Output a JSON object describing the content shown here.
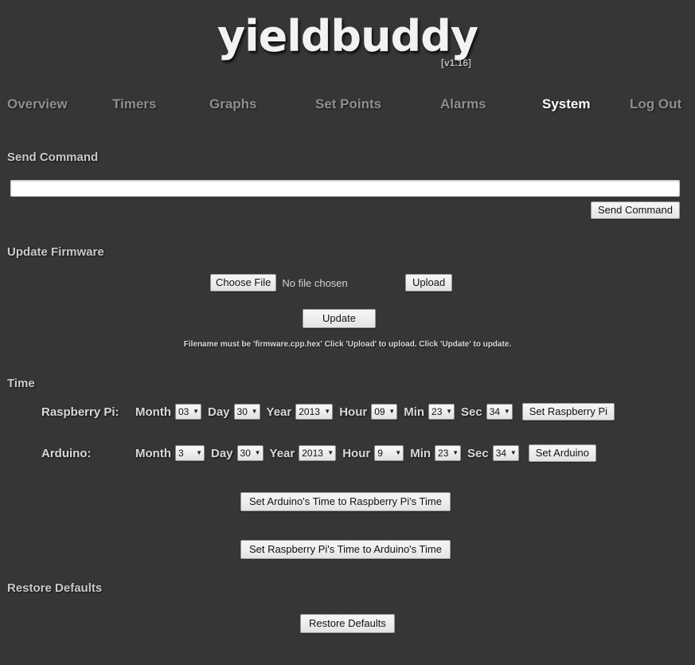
{
  "header": {
    "logo": "yieldbuddy",
    "version": "[v1.16]"
  },
  "nav": {
    "items": [
      {
        "label": "Overview",
        "active": false
      },
      {
        "label": "Timers",
        "active": false
      },
      {
        "label": "Graphs",
        "active": false
      },
      {
        "label": "Set Points",
        "active": false
      },
      {
        "label": "Alarms",
        "active": false
      },
      {
        "label": "System",
        "active": true
      },
      {
        "label": "Log Out",
        "active": false
      }
    ]
  },
  "send_command": {
    "title": "Send Command",
    "input_value": "",
    "input_placeholder": "",
    "button_label": "Send Command"
  },
  "update_firmware": {
    "title": "Update Firmware",
    "choose_file_label": "Choose File",
    "file_status": "No file chosen",
    "upload_label": "Upload",
    "update_label": "Update",
    "hint": "Filename must be 'firmware.cpp.hex' Click 'Upload' to upload. Click 'Update' to update."
  },
  "time": {
    "title": "Time",
    "labels": {
      "month": "Month",
      "day": "Day",
      "year": "Year",
      "hour": "Hour",
      "min": "Min",
      "sec": "Sec"
    },
    "raspberry_pi": {
      "device_label": "Raspberry Pi:",
      "month": "03",
      "day": "30",
      "year": "2013",
      "hour": "09",
      "min": "23",
      "sec": "34",
      "button_label": "Set Raspberry Pi"
    },
    "arduino": {
      "device_label": "Arduino:",
      "month": "3",
      "day": "30",
      "year": "2013",
      "hour": "9",
      "min": "23",
      "sec": "34",
      "button_label": "Set Arduino"
    },
    "sync_arduino_label": "Set Arduino's Time to Raspberry Pi's Time",
    "sync_rpi_label": "Set Raspberry Pi's Time to Arduino's Time"
  },
  "restore_defaults": {
    "title": "Restore Defaults",
    "button_label": "Restore Defaults"
  },
  "colors": {
    "background": "#363636",
    "heading": "#c9c9c9",
    "nav_inactive": "#8e8e8e",
    "nav_active": "#ffffff",
    "button_face": "#efefef"
  }
}
